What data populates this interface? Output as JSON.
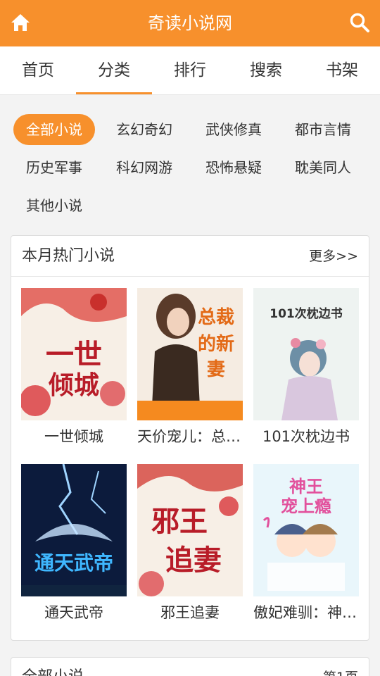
{
  "header": {
    "title": "奇读小说网",
    "home_icon": "home-icon",
    "search_icon": "search-icon"
  },
  "tabs": [
    {
      "label": "首页",
      "active": false
    },
    {
      "label": "分类",
      "active": true
    },
    {
      "label": "排行",
      "active": false
    },
    {
      "label": "搜索",
      "active": false
    },
    {
      "label": "书架",
      "active": false
    }
  ],
  "categories": [
    {
      "label": "全部小说",
      "active": true
    },
    {
      "label": "玄幻奇幻",
      "active": false
    },
    {
      "label": "武侠修真",
      "active": false
    },
    {
      "label": "都市言情",
      "active": false
    },
    {
      "label": "历史军事",
      "active": false
    },
    {
      "label": "科幻网游",
      "active": false
    },
    {
      "label": "恐怖悬疑",
      "active": false
    },
    {
      "label": "耽美同人",
      "active": false
    },
    {
      "label": "其他小说",
      "active": false
    }
  ],
  "hot": {
    "title": "本月热门小说",
    "more": "更多>>",
    "books": [
      {
        "name": "一世倾城",
        "cover_text": "一世倾城"
      },
      {
        "name": "天价宠儿：总裁的新妻",
        "cover_text": "总裁的新妻"
      },
      {
        "name": "101次枕边书",
        "cover_text": "101次枕边书"
      },
      {
        "name": "通天武帝",
        "cover_text": "通天武帝"
      },
      {
        "name": "邪王追妻",
        "cover_text": "邪王追妻"
      },
      {
        "name": "傲妃难驯：神王宠上瘾",
        "cover_text": "神王宠上瘾"
      }
    ]
  },
  "all": {
    "title": "全部小说",
    "page": "第1页"
  },
  "colors": {
    "accent": "#f7902c"
  }
}
